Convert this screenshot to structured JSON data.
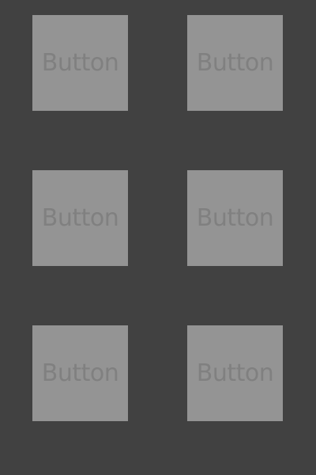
{
  "colors": {
    "background": "#414141",
    "button_fill": "#949494",
    "button_text": "#808080"
  },
  "buttons": [
    {
      "label": "Button"
    },
    {
      "label": "Button"
    },
    {
      "label": "Button"
    },
    {
      "label": "Button"
    },
    {
      "label": "Button"
    },
    {
      "label": "Button"
    }
  ]
}
